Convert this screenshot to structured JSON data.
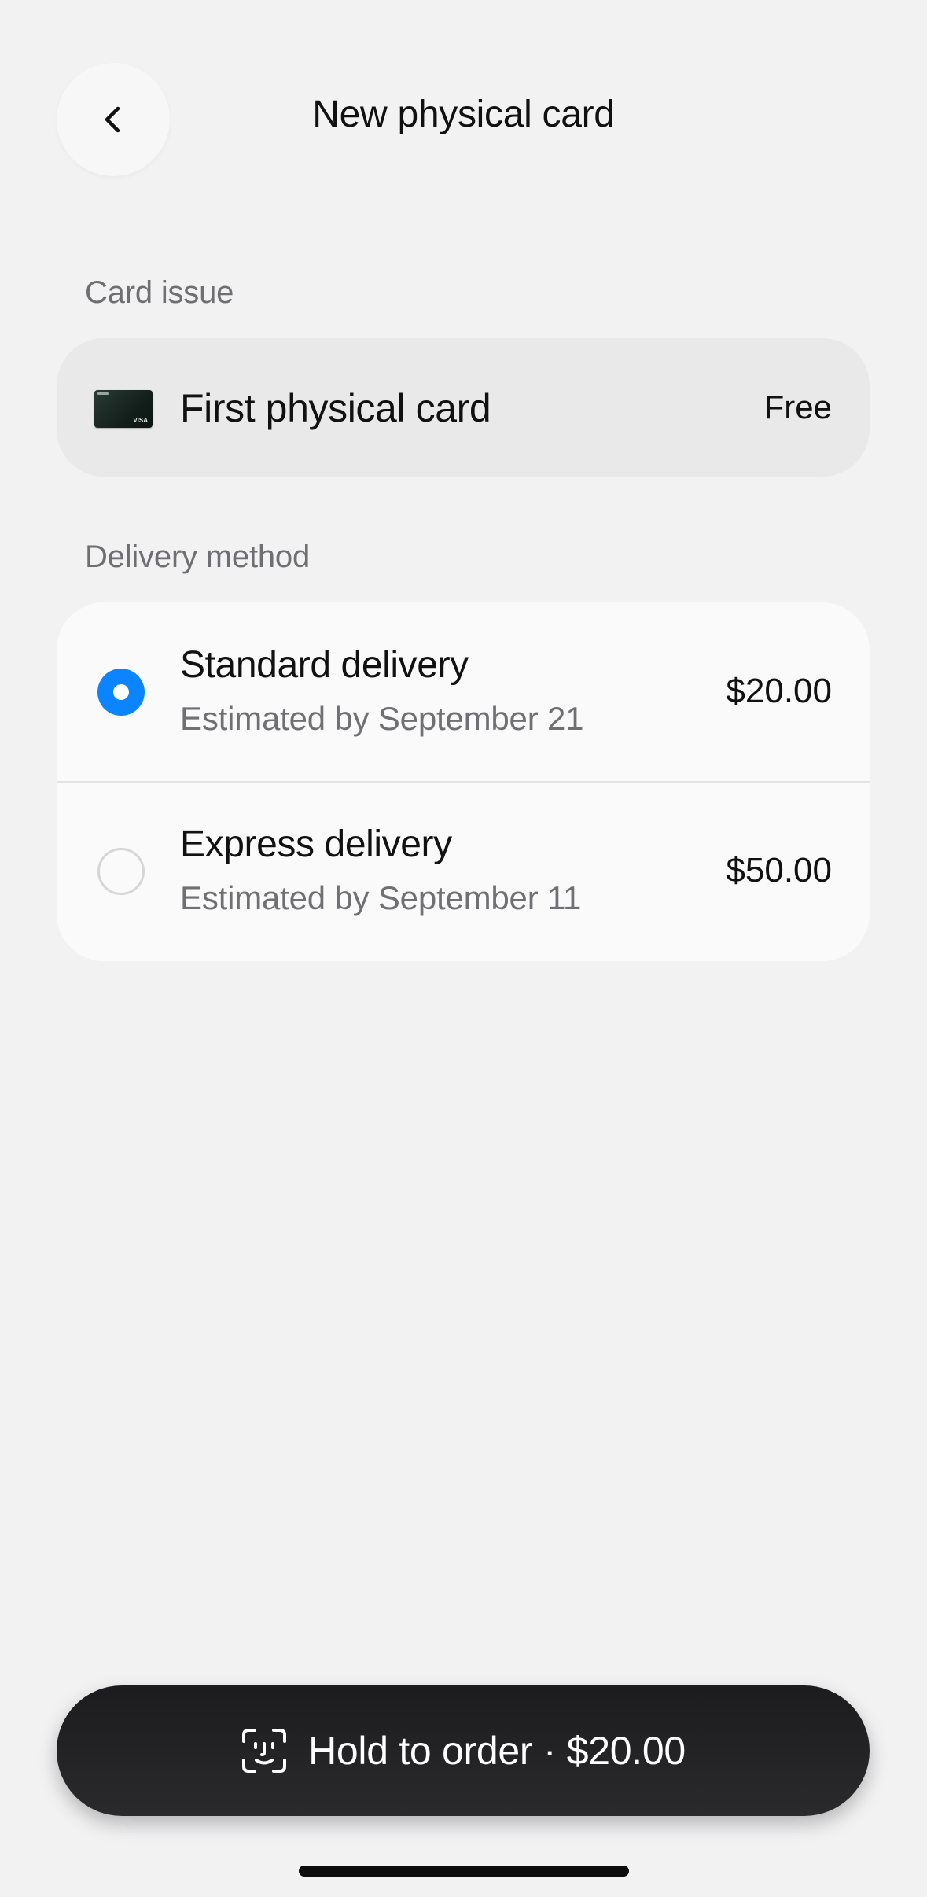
{
  "header": {
    "title": "New physical card",
    "back_icon": "chevron-left-icon"
  },
  "card_issue": {
    "label": "Card issue",
    "option": {
      "title": "First physical card",
      "price": "Free",
      "card_brand": "VISA"
    }
  },
  "delivery": {
    "label": "Delivery method",
    "options": [
      {
        "title": "Standard delivery",
        "subtitle": "Estimated by September 21",
        "price": "$20.00",
        "selected": true
      },
      {
        "title": "Express delivery",
        "subtitle": "Estimated by September 11",
        "price": "$50.00",
        "selected": false
      }
    ]
  },
  "order_button": {
    "label": "Hold to order · $20.00",
    "icon": "face-id-icon"
  },
  "colors": {
    "accent": "#0a84ff",
    "background": "#f2f2f3",
    "button": "#1c1c1e"
  }
}
